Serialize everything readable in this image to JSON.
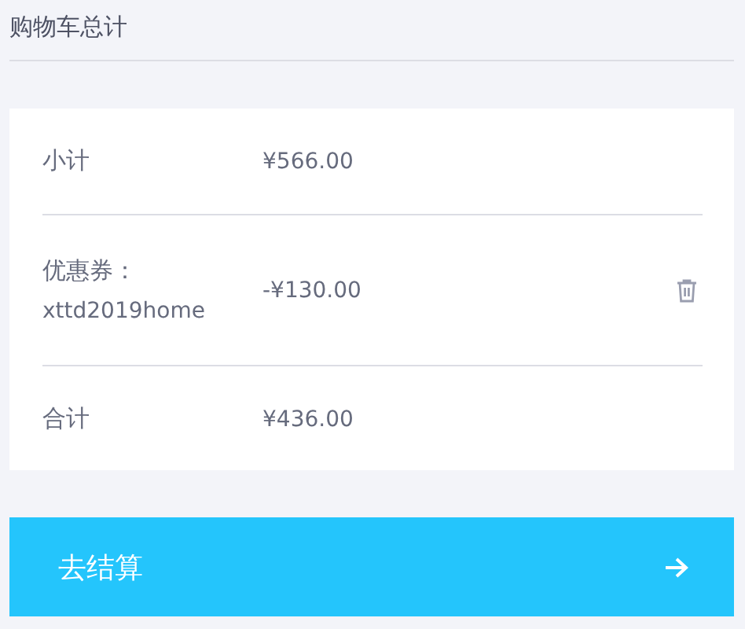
{
  "title": "购物车总计",
  "rows": [
    {
      "kind": "plain",
      "label": "小计",
      "value": "¥566.00"
    },
    {
      "kind": "coupon",
      "label": "优惠券：",
      "code": "xttd2019home",
      "value": "-¥130.00"
    },
    {
      "kind": "plain",
      "label": "合计",
      "value": "¥436.00"
    }
  ],
  "checkout_button": {
    "label": "去结算"
  }
}
